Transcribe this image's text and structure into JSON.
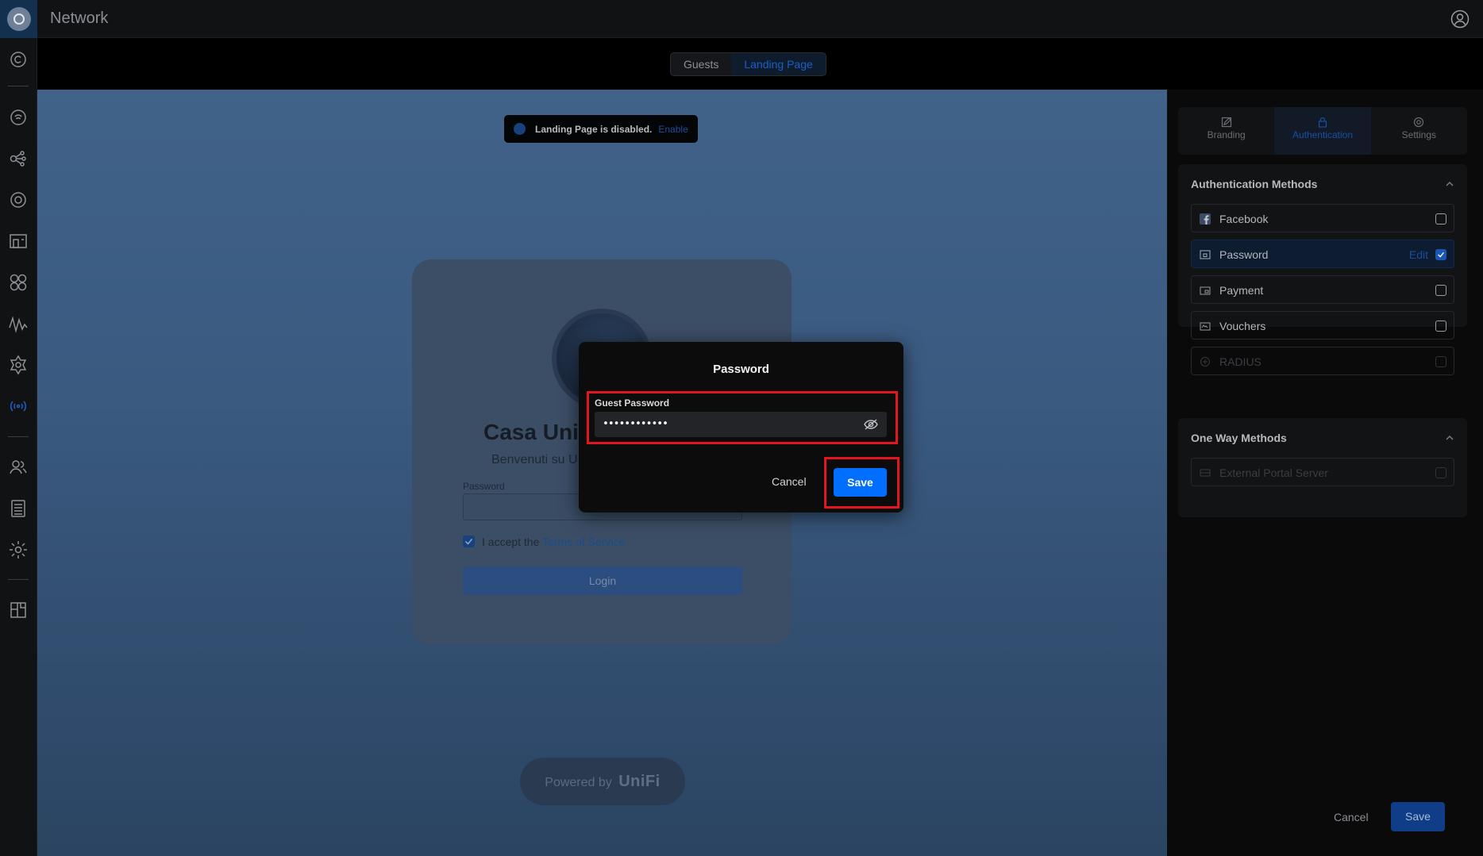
{
  "app": {
    "title": "Network"
  },
  "tabs": {
    "guests": "Guests",
    "landing": "Landing Page"
  },
  "banner": {
    "text": "Landing Page is disabled.",
    "link": "Enable"
  },
  "preview_card": {
    "title": "Casa Uni",
    "subtitle": "Benvenuti su U",
    "password_label": "Password",
    "accept_text": "I accept the ",
    "terms_link": "Terms of Service",
    "login_label": "Login"
  },
  "powered": {
    "prefix": "Powered by",
    "brand": "UniFi"
  },
  "modal": {
    "title": "Password",
    "field_label": "Guest Password",
    "field_value": "••••••••••••",
    "cancel_label": "Cancel",
    "save_label": "Save"
  },
  "right_panel": {
    "tabs": [
      "Branding",
      "Authentication",
      "Settings"
    ],
    "auth_section_title": "Authentication Methods",
    "auth_methods": [
      {
        "label": "Facebook",
        "checked": false
      },
      {
        "label": "Password",
        "checked": true,
        "edit": "Edit"
      },
      {
        "label": "Payment",
        "checked": false
      },
      {
        "label": "Vouchers",
        "checked": false
      },
      {
        "label": "RADIUS",
        "checked": false
      }
    ],
    "oneway_section_title": "One Way Methods",
    "oneway_methods": [
      {
        "label": "External Portal Server",
        "checked": false
      }
    ],
    "cancel_label": "Cancel",
    "save_label": "Save"
  },
  "colors": {
    "accent": "#006fff",
    "highlight": "#e3161f"
  }
}
